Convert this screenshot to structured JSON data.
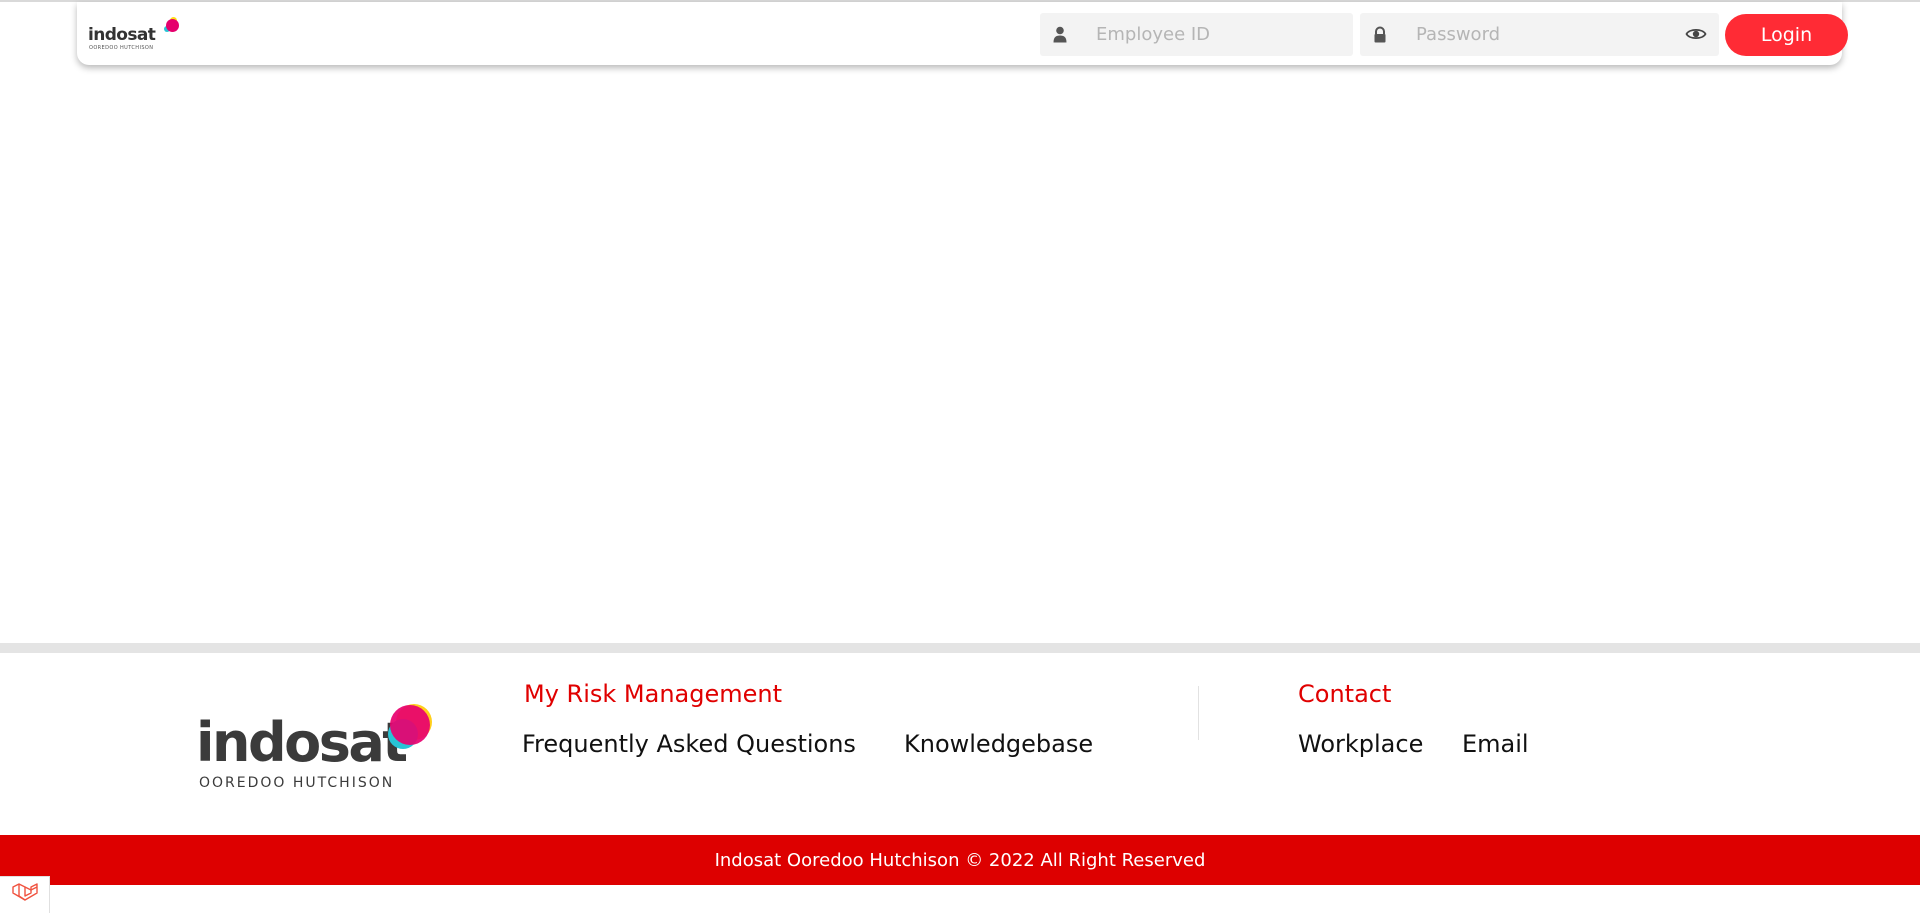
{
  "header": {
    "logo_text": "indosat",
    "logo_subtext": "OOREDOO HUTCHISON",
    "employee_id": {
      "placeholder": "Employee ID",
      "value": "",
      "icon": "user-icon"
    },
    "password": {
      "placeholder": "Password",
      "value": "",
      "icon": "lock-icon",
      "toggle_icon": "eye-icon"
    },
    "login_label": "Login"
  },
  "footer": {
    "logo_text": "indosat",
    "logo_subtext": "OOREDOO HUTCHISON",
    "risk_section": {
      "title": "My Risk Management",
      "links": [
        "Frequently Asked Questions",
        "Knowledgebase"
      ]
    },
    "contact_section": {
      "title": "Contact",
      "links": [
        "Workplace",
        "Email"
      ]
    },
    "copyright": "Indosat Ooredoo Hutchison © 2022 All Right Reserved"
  },
  "debug_badge": {
    "icon": "laravel-icon"
  },
  "colors": {
    "brand_red": "#dd0000",
    "button_red": "#ff2b35",
    "logo_pink": "#e5006d",
    "logo_yellow": "#ffcf1a",
    "logo_cyan": "#27c4d6",
    "input_bg": "#f3f3f3"
  }
}
